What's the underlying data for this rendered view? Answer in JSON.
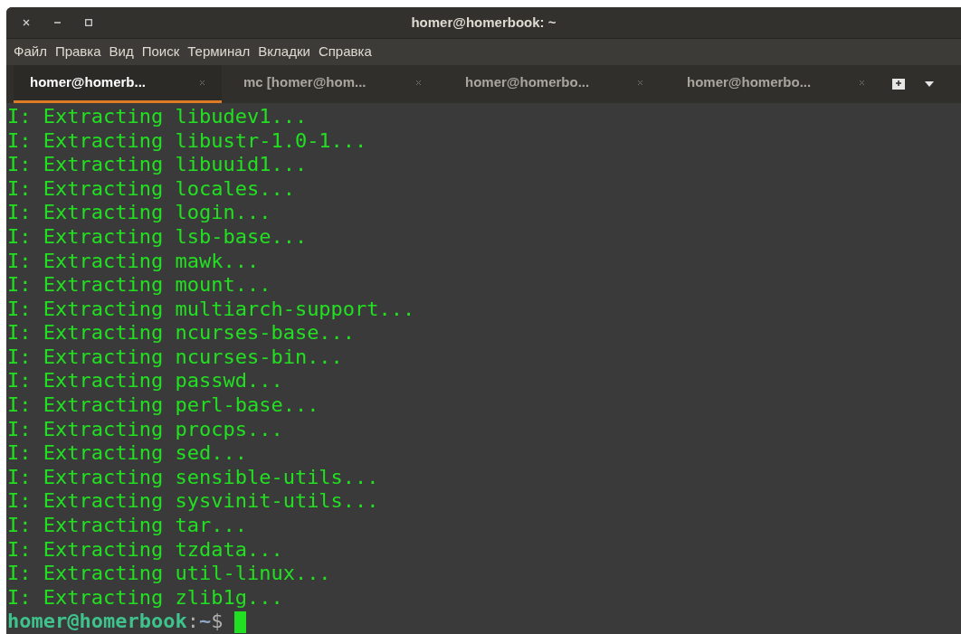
{
  "window": {
    "title": "homer@homerbook: ~"
  },
  "menu": [
    "Файл",
    "Правка",
    "Вид",
    "Поиск",
    "Терминал",
    "Вкладки",
    "Справка"
  ],
  "tabs": [
    {
      "label": "homer@homerb...",
      "selected": true
    },
    {
      "label": "mc [homer@hom...",
      "selected": false
    },
    {
      "label": "homer@homerbo...",
      "selected": false
    },
    {
      "label": "homer@homerbo...",
      "selected": false
    }
  ],
  "terminal": {
    "lines": [
      "I: Extracting libudev1...",
      "I: Extracting libustr-1.0-1...",
      "I: Extracting libuuid1...",
      "I: Extracting locales...",
      "I: Extracting login...",
      "I: Extracting lsb-base...",
      "I: Extracting mawk...",
      "I: Extracting mount...",
      "I: Extracting multiarch-support...",
      "I: Extracting ncurses-base...",
      "I: Extracting ncurses-bin...",
      "I: Extracting passwd...",
      "I: Extracting perl-base...",
      "I: Extracting procps...",
      "I: Extracting sed...",
      "I: Extracting sensible-utils...",
      "I: Extracting sysvinit-utils...",
      "I: Extracting tar...",
      "I: Extracting tzdata...",
      "I: Extracting util-linux...",
      "I: Extracting zlib1g..."
    ],
    "prompt": {
      "user_host": "homer@homerbook",
      "separator": ":",
      "path": "~",
      "symbol": "$"
    }
  }
}
